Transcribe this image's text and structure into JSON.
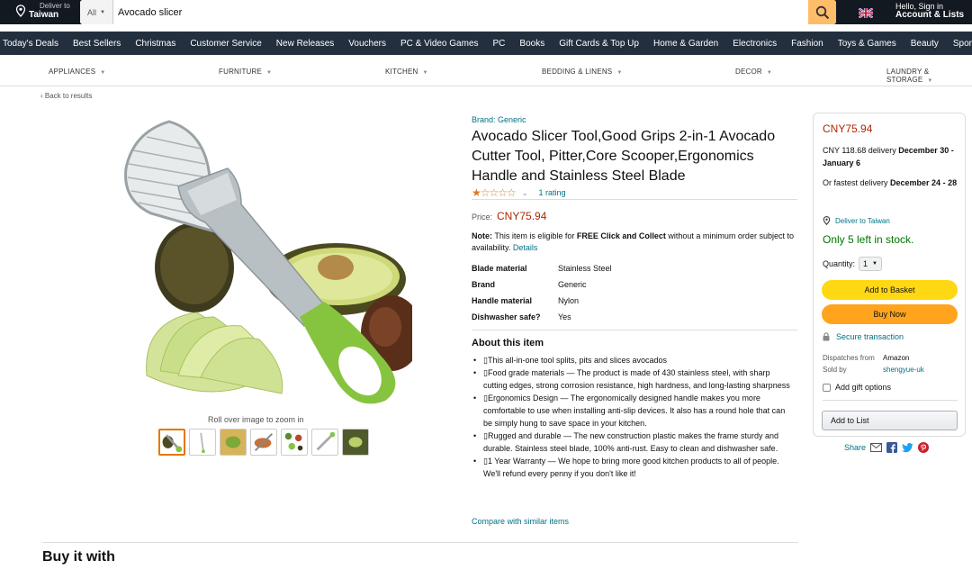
{
  "header": {
    "deliver_small": "Deliver to",
    "deliver_big": "Taiwan",
    "search_category": "All",
    "search_value": "Avocado slicer",
    "account_small": "Hello, Sign in",
    "account_big": "Account & Lists"
  },
  "nav": [
    "Today's Deals",
    "Best Sellers",
    "Christmas",
    "Customer Service",
    "New Releases",
    "Vouchers",
    "PC & Video Games",
    "PC",
    "Books",
    "Gift Cards & Top Up",
    "Home & Garden",
    "Electronics",
    "Fashion",
    "Toys & Games",
    "Beauty",
    "Sports & Outdoors"
  ],
  "categories": [
    "APPLIANCES",
    "FURNITURE",
    "KITCHEN",
    "BEDDING & LINENS",
    "DECOR",
    "LAUNDRY & STORAGE"
  ],
  "back_link": "‹ Back to results",
  "gallery": {
    "zoom_text": "Roll over image to zoom in"
  },
  "product": {
    "brand": "Brand: Generic",
    "title": "Avocado Slicer Tool,Good Grips 2-in-1 Avocado Cutter Tool, Pitter,Core Scooper,Ergonomics Handle and Stainless Steel Blade",
    "stars": "★☆☆☆☆",
    "rating_count": "1 rating",
    "price_label": "Price:",
    "price": "CNY75.94",
    "note_label": "Note:",
    "note_text1": " This item is eligible for ",
    "note_bold": "FREE Click and Collect",
    "note_text2": " without a minimum order subject to availability. ",
    "note_link": "Details",
    "specs": [
      {
        "key": "Blade material",
        "value": "Stainless Steel"
      },
      {
        "key": "Brand",
        "value": "Generic"
      },
      {
        "key": "Handle material",
        "value": "Nylon"
      },
      {
        "key": "Dishwasher safe?",
        "value": "Yes"
      }
    ],
    "about_heading": "About this item",
    "about": [
      "▯This all-in-one tool splits, pits and slices avocados",
      "▯Food grade materials — The product is made of 430 stainless steel, with sharp cutting edges, strong corrosion resistance, high hardness, and long-lasting sharpness",
      "▯Ergonomics Design — The ergonomically designed handle makes you more comfortable to use when installing anti-slip devices. It also has a round hole that can be simply hung to save space in your kitchen.",
      "▯Rugged and durable — The new construction plastic makes the frame sturdy and durable. Stainless steel blade, 100% anti-rust. Easy to clean and dishwasher safe.",
      "▯1 Year Warranty — We hope to bring more good kitchen products to all of people. We'll refund every penny if you don't like it!"
    ],
    "compare": "Compare with similar items"
  },
  "buy_it_with": "Buy it with",
  "buybox": {
    "price": "CNY75.94",
    "delivery_text": "CNY 118.68 delivery ",
    "delivery_dates": "December 30 - January 6",
    "fast_text": "Or fastest delivery ",
    "fast_dates": "December 24 - 28",
    "deliver_to": "Deliver to Taiwan",
    "stock": "Only 5 left in stock.",
    "qty_label": "Quantity:",
    "qty_value": "1",
    "add_to_basket": "Add to Basket",
    "buy_now": "Buy Now",
    "secure": "Secure transaction",
    "dispatches_label": "Dispatches from",
    "dispatches_value": "Amazon",
    "sold_label": "Sold by",
    "sold_value": "shengyue-uk",
    "gift_label": "Add gift options",
    "add_to_list": "Add to List"
  },
  "share_label": "Share",
  "colors": {
    "nav_dark": "#131921",
    "nav_mid": "#232f3e",
    "price": "#b12704",
    "link": "#007185",
    "stock": "#007600",
    "cart": "#ffd814",
    "buy": "#ffa41c"
  }
}
